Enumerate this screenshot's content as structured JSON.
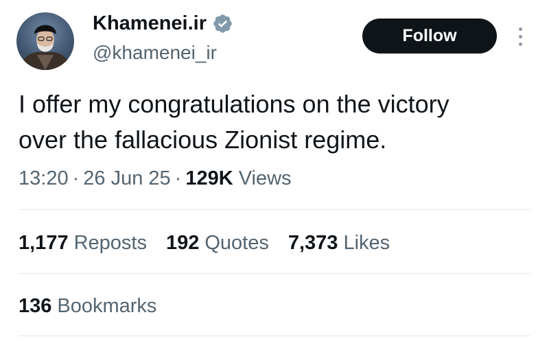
{
  "author": {
    "display_name": "Khamenei.ir",
    "handle": "@khamenei_ir",
    "verified_icon": "verified-badge-icon",
    "avatar": "profile-photo"
  },
  "actions": {
    "follow_label": "Follow",
    "more_icon": "more-vertical-icon"
  },
  "tweet": {
    "line1": "I offer my congratulations on the victory",
    "line2": "over the fallacious Zionist regime."
  },
  "meta": {
    "time": "13:20",
    "separator": "·",
    "date": "26 Jun 25",
    "views_count": "129K",
    "views_label": "Views"
  },
  "stats": {
    "reposts_count": "1,177",
    "reposts_label": "Reposts",
    "quotes_count": "192",
    "quotes_label": "Quotes",
    "likes_count": "7,373",
    "likes_label": "Likes",
    "bookmarks_count": "136",
    "bookmarks_label": "Bookmarks"
  },
  "colors": {
    "text": "#0f1419",
    "secondary": "#536471",
    "verified": "#829aab",
    "follow_bg": "#0f1419",
    "divider": "#e1e8ed"
  }
}
